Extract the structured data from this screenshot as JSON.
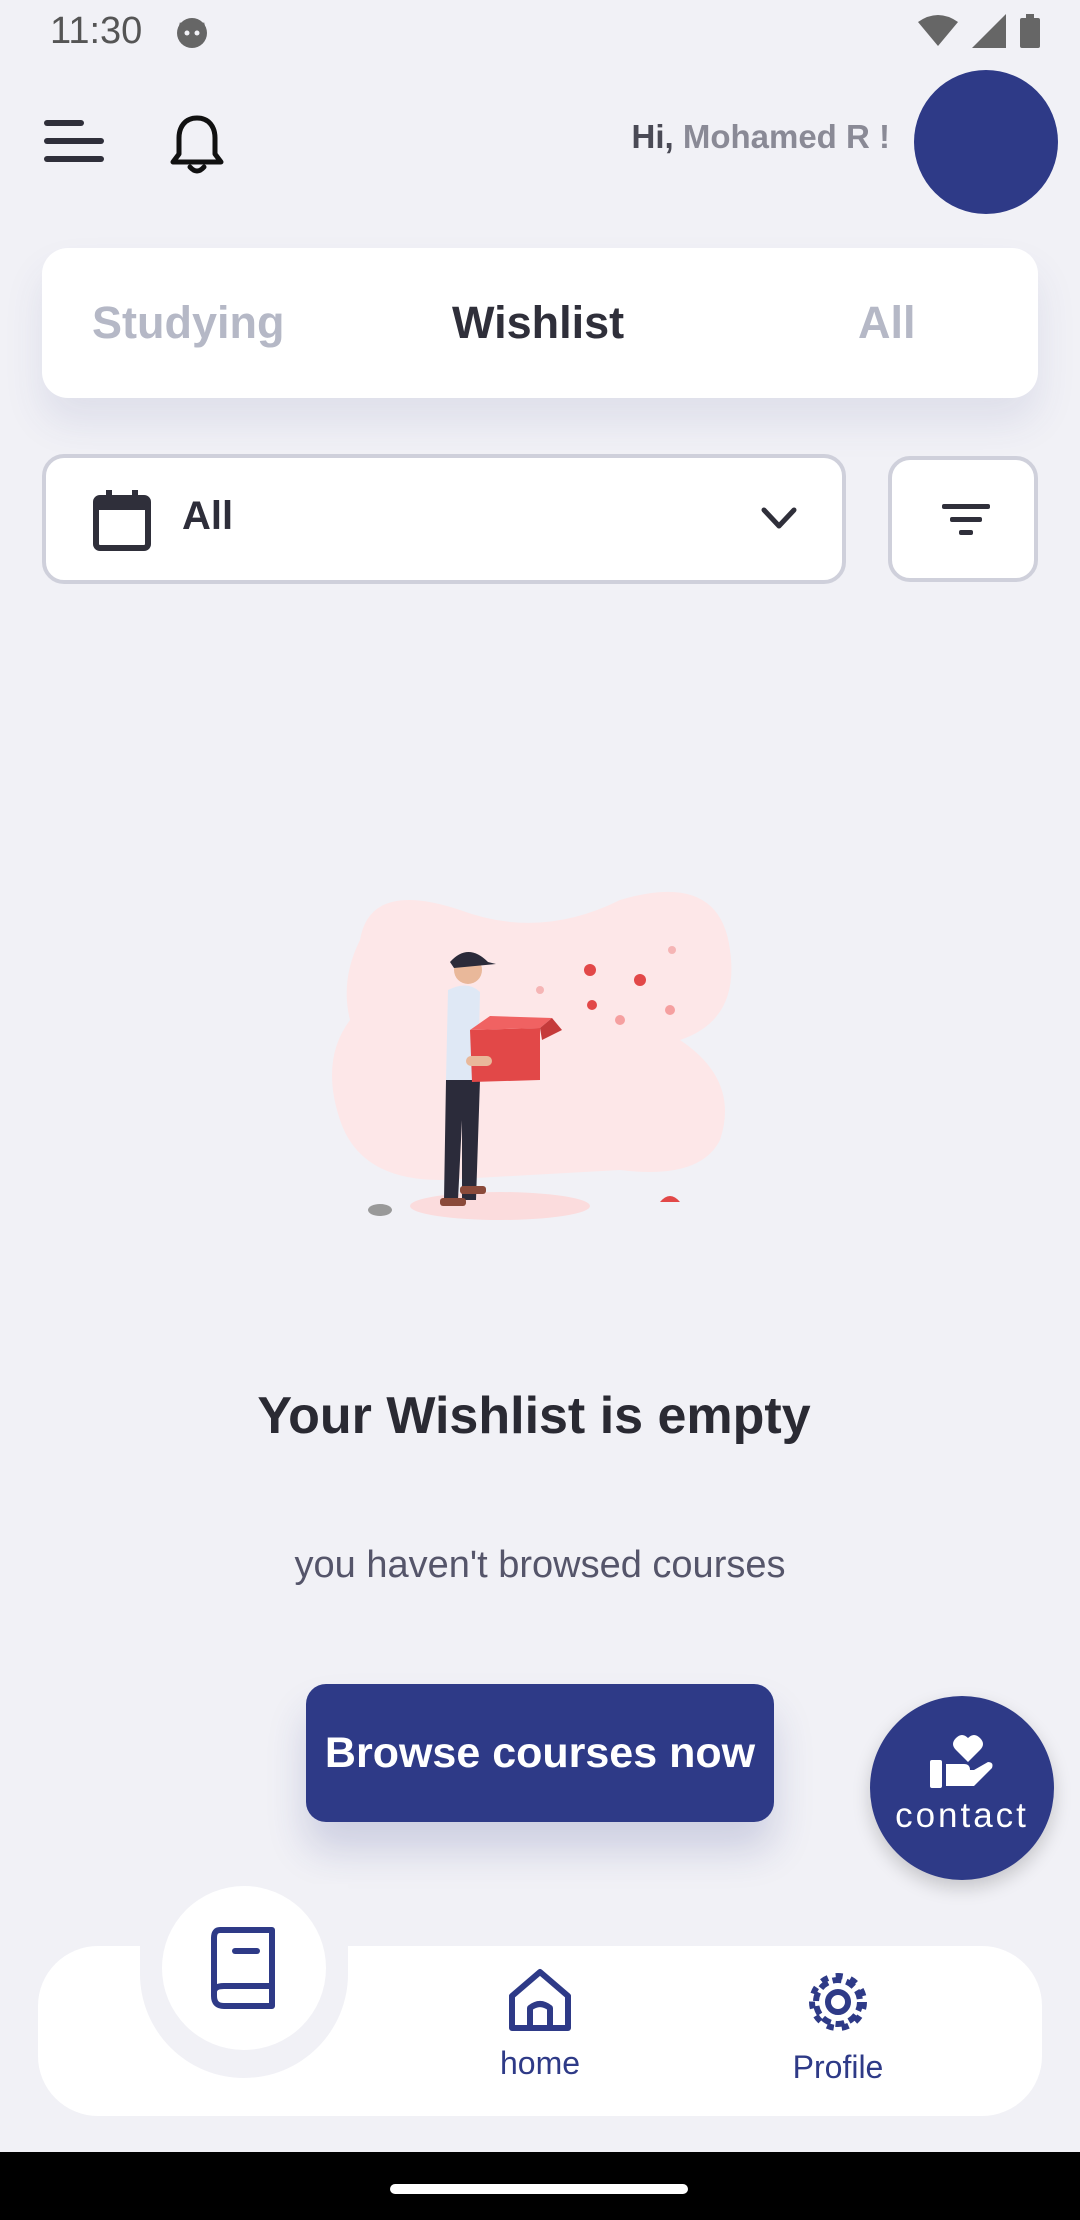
{
  "status_bar": {
    "time": "11:30"
  },
  "header": {
    "greeting_hi": "Hi,",
    "greeting_name": "Mohamed R !"
  },
  "tabs": {
    "studying": "Studying",
    "wishlist": "Wishlist",
    "all": "All",
    "active": "Wishlist"
  },
  "filter": {
    "date_value": "All"
  },
  "empty_state": {
    "title": "Your Wishlist is empty",
    "subtitle": "you haven't browsed courses",
    "button_label": "Browse courses now"
  },
  "contact_fab": {
    "label": "contact"
  },
  "bottom_nav": {
    "home_label": "home",
    "profile_label": "Profile"
  },
  "colors": {
    "primary": "#2e3a87",
    "background": "#f1f1f6",
    "inactive_tab": "#b5b8c6"
  }
}
